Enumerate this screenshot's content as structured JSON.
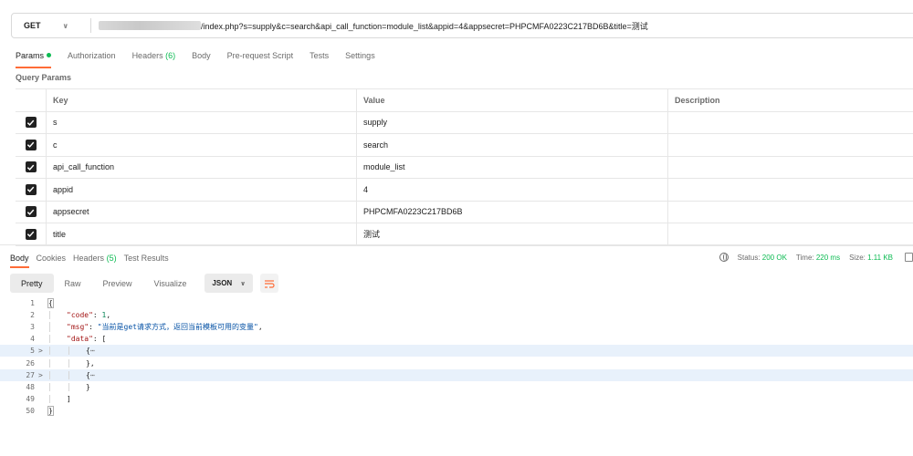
{
  "request": {
    "method": "GET",
    "url_suffix": "/index.php?s=supply&c=search&api_call_function=module_list&appid=4&appsecret=PHPCMFA0223C217BD6B&title=测试"
  },
  "request_tabs": [
    {
      "label": "Params",
      "active": true,
      "dot": true
    },
    {
      "label": "Authorization"
    },
    {
      "label": "Headers",
      "count": "(6)"
    },
    {
      "label": "Body"
    },
    {
      "label": "Pre-request Script"
    },
    {
      "label": "Tests"
    },
    {
      "label": "Settings"
    }
  ],
  "query_params": {
    "label": "Query Params",
    "columns": {
      "key": "Key",
      "value": "Value",
      "description": "Description"
    },
    "rows": [
      {
        "key": "s",
        "value": "supply",
        "checked": true
      },
      {
        "key": "c",
        "value": "search",
        "checked": true
      },
      {
        "key": "api_call_function",
        "value": "module_list",
        "checked": true
      },
      {
        "key": "appid",
        "value": "4",
        "checked": true
      },
      {
        "key": "appsecret",
        "value": "PHPCMFA0223C217BD6B",
        "checked": true
      },
      {
        "key": "title",
        "value": "测试",
        "checked": true
      }
    ]
  },
  "response_tabs": [
    {
      "label": "Body",
      "active": true
    },
    {
      "label": "Cookies"
    },
    {
      "label": "Headers",
      "count": "(5)"
    },
    {
      "label": "Test Results"
    }
  ],
  "response_status": {
    "status_label": "Status:",
    "status_value": "200 OK",
    "time_label": "Time:",
    "time_value": "220 ms",
    "size_label": "Size:",
    "size_value": "1.11 KB"
  },
  "view_modes": [
    "Pretty",
    "Raw",
    "Preview",
    "Visualize"
  ],
  "active_view": "Pretty",
  "format": "JSON",
  "code_lines": [
    {
      "n": "1",
      "text": "{"
    },
    {
      "n": "2",
      "text": "\"code\": 1,"
    },
    {
      "n": "3",
      "text": "\"msg\": \"当前是get请求方式，返回当前模板可用的变量\","
    },
    {
      "n": "4",
      "text": "\"data\": ["
    },
    {
      "n": "5",
      "text": "{⋯",
      "fold": ">"
    },
    {
      "n": "26",
      "text": "},"
    },
    {
      "n": "27",
      "text": "{⋯",
      "fold": ">"
    },
    {
      "n": "48",
      "text": "}"
    },
    {
      "n": "49",
      "text": "]"
    },
    {
      "n": "50",
      "text": "}"
    }
  ]
}
